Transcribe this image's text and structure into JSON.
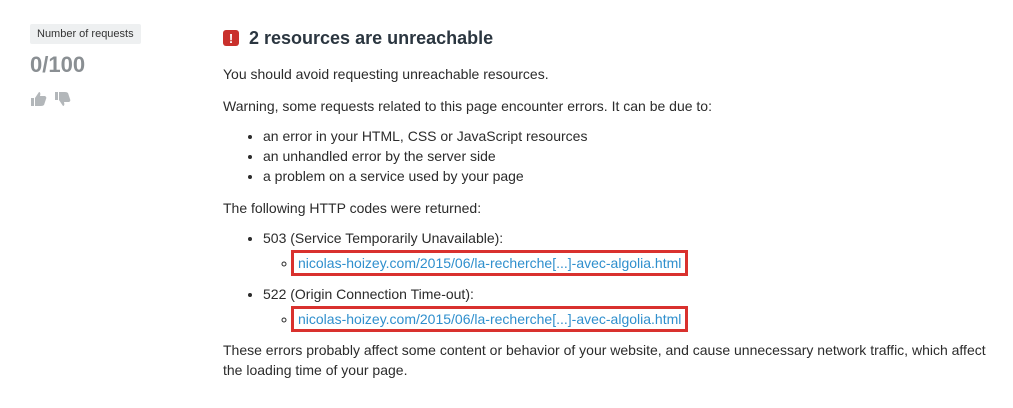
{
  "sidebar": {
    "badge": "Number of requests",
    "score": "0/100",
    "icons": [
      "thumbs-up-icon",
      "thumbs-down-icon"
    ]
  },
  "main": {
    "icon": "exclamation",
    "title": "2 resources are unreachable",
    "intro": "You should avoid requesting unreachable resources.",
    "warning": "Warning, some requests related to this page encounter errors. It can be due to:",
    "reasons": [
      "an error in your HTML, CSS or JavaScript resources",
      "an unhandled error by the server side",
      "a problem on a service used by your page"
    ],
    "codes_intro": "The following HTTP codes were returned:",
    "codes": [
      {
        "label": "503 (Service Temporarily Unavailable):",
        "url": "nicolas-hoizey.com/2015/06/la-recherche[...]-avec-algolia.html"
      },
      {
        "label": "522 (Origin Connection Time-out):",
        "url": "nicolas-hoizey.com/2015/06/la-recherche[...]-avec-algolia.html"
      }
    ],
    "conclusion": "These errors probably affect some content or behavior of your website, and cause unnecessary network traffic, which affect the loading time of your page."
  },
  "colors": {
    "danger": "#c9302c",
    "highlight": "#d9312e",
    "link": "#2f8fcd",
    "muted": "#8a8f93"
  }
}
